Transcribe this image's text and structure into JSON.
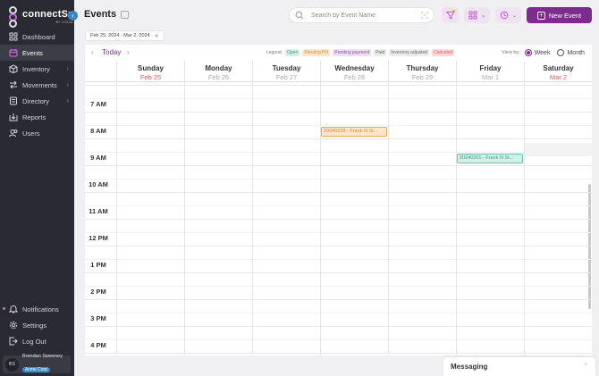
{
  "app": {
    "name": "connectSx",
    "tagline": "BY VOCAL"
  },
  "sidebar": {
    "items": [
      {
        "label": "Dashboard",
        "icon": "dashboard-icon",
        "active": false
      },
      {
        "label": "Events",
        "icon": "calendar-icon",
        "active": true
      },
      {
        "label": "Inventory",
        "icon": "box-icon",
        "active": false,
        "has_children": true
      },
      {
        "label": "Movements",
        "icon": "arrows-icon",
        "active": false,
        "has_children": true
      },
      {
        "label": "Directory",
        "icon": "directory-icon",
        "active": false,
        "has_children": true
      },
      {
        "label": "Reports",
        "icon": "reports-icon",
        "active": false
      },
      {
        "label": "Users",
        "icon": "users-icon",
        "active": false
      }
    ],
    "bottom_items": [
      {
        "label": "Notifications",
        "icon": "bell-icon"
      },
      {
        "label": "Settings",
        "icon": "gear-icon"
      },
      {
        "label": "Log Out",
        "icon": "logout-icon"
      }
    ],
    "user": {
      "initials": "BS",
      "name": "Brendan Sweeney",
      "org": "Acme Corp"
    }
  },
  "header": {
    "title": "Events",
    "search_placeholder": "Search by Event Name",
    "new_event_label": "New Event"
  },
  "filters": {
    "date_range": "Feb 25, 2024 - Mar 2, 2024"
  },
  "calendar": {
    "today_label": "Today",
    "legend_label": "Legend:",
    "legend": [
      {
        "label": "Open",
        "bg": "#d3f0e8",
        "fg": "#3b9e82"
      },
      {
        "label": "Pending PO",
        "bg": "#fde7cc",
        "fg": "#d98a2b"
      },
      {
        "label": "Pending payment",
        "bg": "#ece0f3",
        "fg": "#8c4fa6"
      },
      {
        "label": "Paid",
        "bg": "#ececec",
        "fg": "#666"
      },
      {
        "label": "Inventory adjusted",
        "bg": "#ececec",
        "fg": "#666"
      },
      {
        "label": "Canceled",
        "bg": "#fbd9d9",
        "fg": "#d65c5c"
      }
    ],
    "view_by_label": "View by:",
    "view_options": [
      {
        "label": "Week",
        "selected": true
      },
      {
        "label": "Month",
        "selected": false
      }
    ],
    "days": [
      {
        "name": "Sunday",
        "date": "Feb 25",
        "highlight": true
      },
      {
        "name": "Monday",
        "date": "Feb 26",
        "highlight": false
      },
      {
        "name": "Tuesday",
        "date": "Feb 27",
        "highlight": false
      },
      {
        "name": "Wednesday",
        "date": "Feb 28",
        "highlight": false
      },
      {
        "name": "Thursday",
        "date": "Feb 29",
        "highlight": false
      },
      {
        "name": "Friday",
        "date": "Mar 1",
        "highlight": false
      },
      {
        "name": "Saturday",
        "date": "Mar 2",
        "highlight": true
      }
    ],
    "hours": [
      "7 AM",
      "8 AM",
      "9 AM",
      "10 AM",
      "11 AM",
      "12 PM",
      "1 PM",
      "2 PM",
      "3 PM",
      "4 PM"
    ],
    "events": [
      {
        "label": "20240228 - Frank N St...",
        "day": 3,
        "hour": "8 AM",
        "status": "pending"
      },
      {
        "label": "20240301 - Frank N St...",
        "day": 5,
        "hour": "9 AM",
        "status": "open"
      }
    ]
  },
  "messaging": {
    "title": "Messaging"
  }
}
